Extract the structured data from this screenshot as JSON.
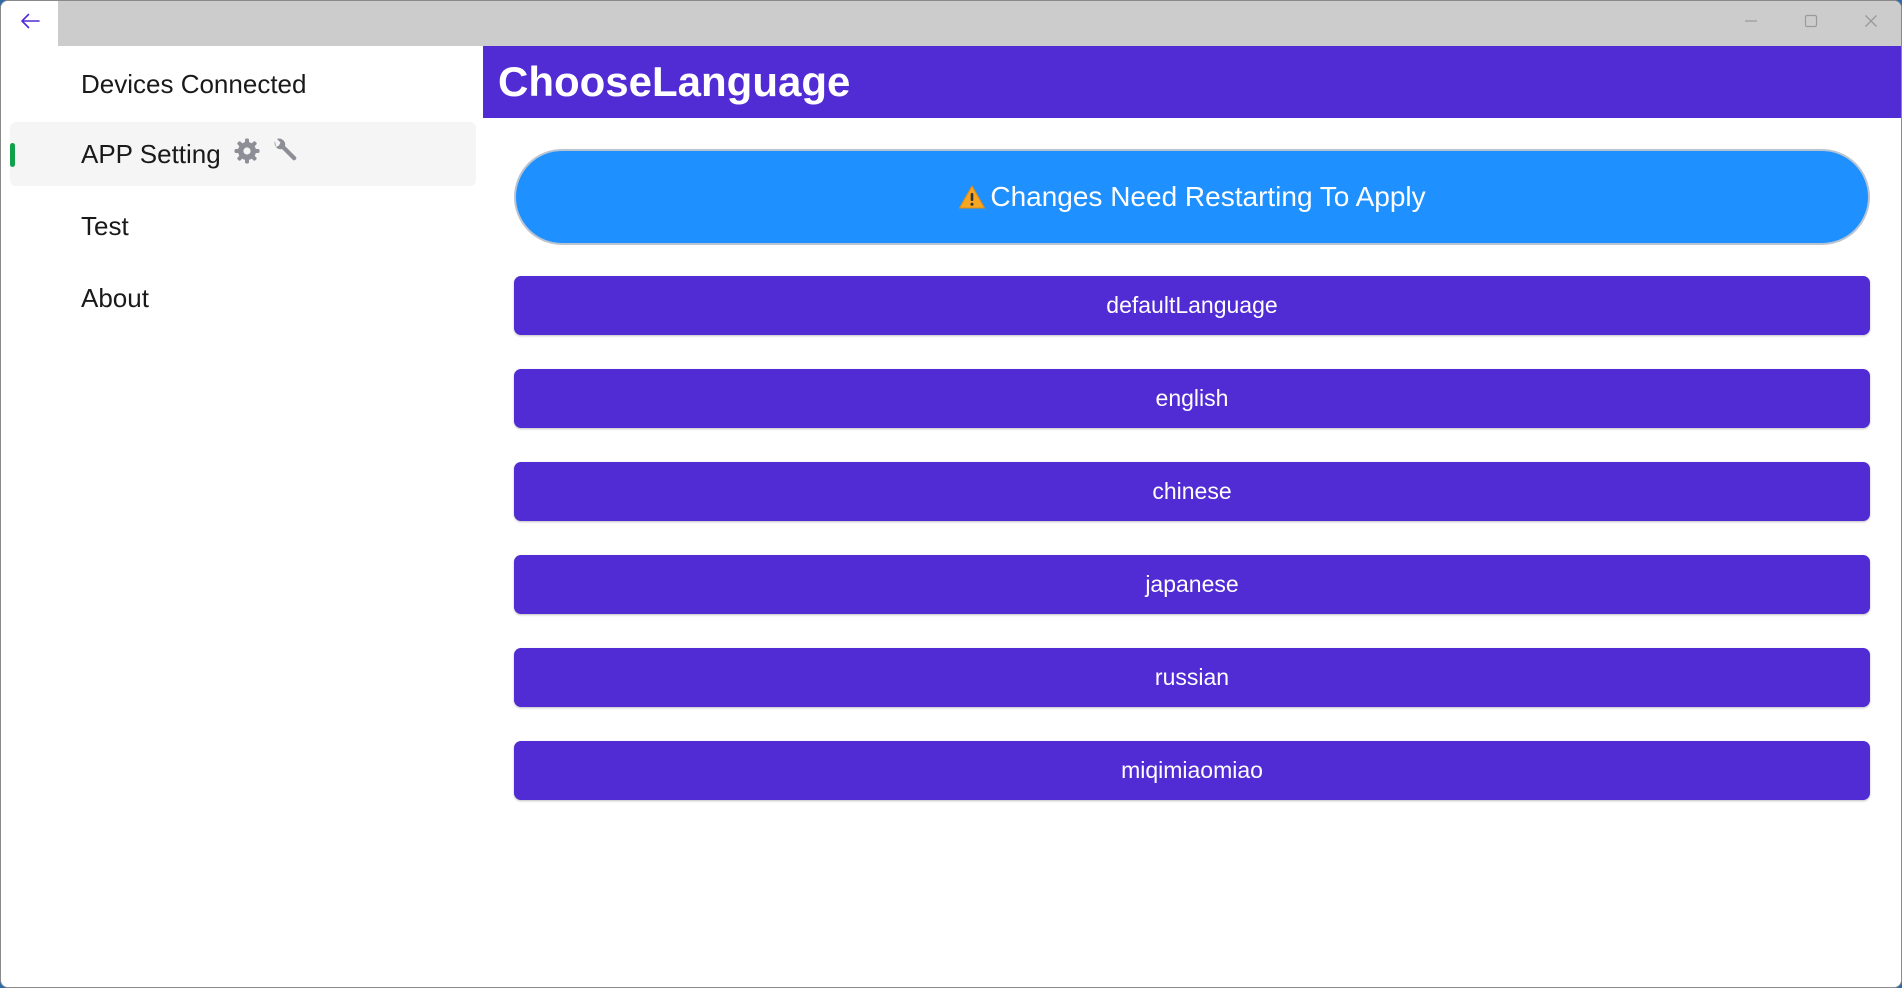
{
  "window": {
    "back_icon": "arrow-left-icon",
    "caption_buttons": [
      "minimize-icon",
      "maximize-icon",
      "close-icon"
    ]
  },
  "sidebar": {
    "items": [
      {
        "label": "Devices Connected",
        "selected": false
      },
      {
        "label": "APP Setting",
        "selected": true,
        "icons": [
          "gear-icon",
          "wrench-icon"
        ]
      },
      {
        "label": "Test",
        "selected": false
      },
      {
        "label": "About",
        "selected": false
      }
    ],
    "indicator_color": "#12a14b"
  },
  "header": {
    "title": "ChooseLanguage",
    "color": "#512bd4"
  },
  "warning": {
    "icon": "warning-icon",
    "label": "Changes Need Restarting To Apply",
    "color": "#1e90ff"
  },
  "languages": [
    {
      "label": "defaultLanguage"
    },
    {
      "label": "english"
    },
    {
      "label": "chinese"
    },
    {
      "label": "japanese"
    },
    {
      "label": "russian"
    },
    {
      "label": "miqimiaomiao"
    }
  ],
  "colors": {
    "accent": "#512bd4",
    "titlebar": "#cccccc"
  }
}
